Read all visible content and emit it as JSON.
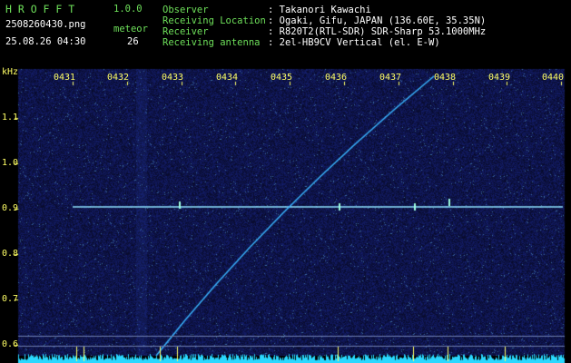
{
  "app": {
    "name": "H R O F F T",
    "version": "1.0.0"
  },
  "file": {
    "filename": "2508260430.png",
    "datetime": "25.08.26 04:30"
  },
  "meteor": {
    "label": "meteor",
    "count": "26"
  },
  "info": [
    {
      "label": "Observer",
      "value": ": Takanori Kawachi"
    },
    {
      "label": "Receiving Location",
      "value": ": Ogaki, Gifu, JAPAN (136.60E, 35.35N)"
    },
    {
      "label": "Receiver",
      "value": ": R820T2(RTL-SDR) SDR-Sharp 53.1000MHz"
    },
    {
      "label": "Receiving antenna",
      "value": ": 2el-HB9CV Vertical (el. E-W)"
    }
  ],
  "axis": {
    "unit": "kHz",
    "time_ticks": [
      "0431",
      "0432",
      "0433",
      "0434",
      "0435",
      "0436",
      "0437",
      "0438",
      "0439",
      "0440"
    ],
    "freq_ticks": [
      "1.1",
      "1.0",
      "0.9",
      "0.8",
      "0.7",
      "0.6"
    ]
  },
  "colors": {
    "background": "#000000",
    "spectrogram_bg": "#0b0b4a",
    "header_green": "#6ee05a",
    "tick_yellow": "#ffff66",
    "signal_cyan": "#39b4ff",
    "baseline_cyan": "#2ad8ff"
  }
}
